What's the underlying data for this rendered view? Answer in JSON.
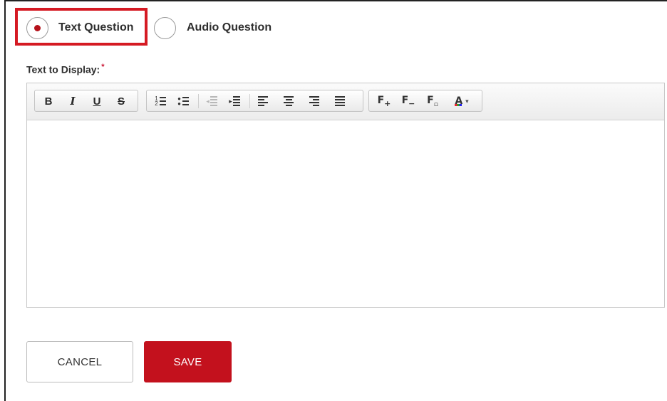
{
  "question_type": {
    "options": [
      {
        "label": "Text Question",
        "selected": true
      },
      {
        "label": "Audio Question",
        "selected": false
      }
    ]
  },
  "editor": {
    "label": "Text to Display:",
    "required_marker": "*",
    "toolbar": {
      "bold": "B",
      "italic": "I",
      "underline": "U",
      "strikethrough": "S",
      "tools": [
        "bold-icon",
        "italic-icon",
        "underline-icon",
        "strikethrough-icon",
        "ordered-list-icon",
        "unordered-list-icon",
        "outdent-icon",
        "indent-icon",
        "align-left-icon",
        "align-center-icon",
        "align-right-icon",
        "align-justify-icon",
        "font-size-increase-icon",
        "font-size-decrease-icon",
        "font-size-reset-icon",
        "text-color-icon"
      ]
    },
    "content": ""
  },
  "actions": {
    "cancel_label": "CANCEL",
    "save_label": "SAVE"
  },
  "colors": {
    "accent": "#c3111d",
    "highlight_border": "#d51a23",
    "required": "#c8102e"
  }
}
